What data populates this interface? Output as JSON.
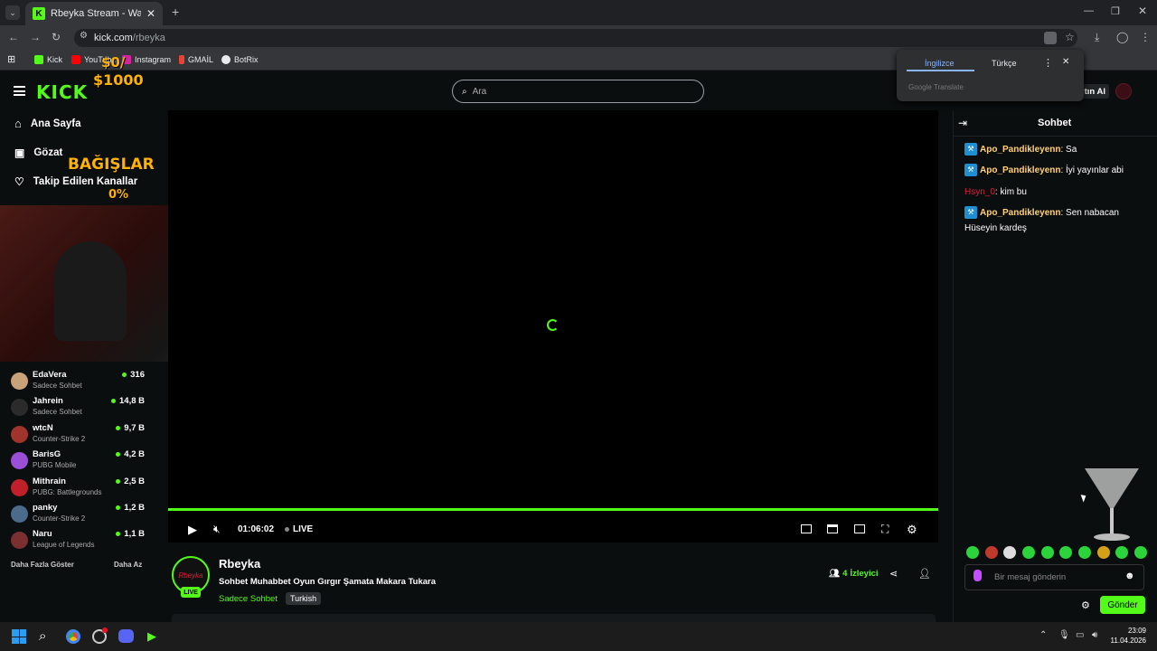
{
  "browser": {
    "tab_title": "Rbeyka Stream - Watch Live on",
    "url_host": "kick.com",
    "url_path": "/rbeyka",
    "bookmarks": [
      "Kick",
      "YouTube",
      "Instagram",
      "GMAİL",
      "BotRix"
    ]
  },
  "translate": {
    "lang_from": "İngilizce",
    "lang_to": "Türkçe",
    "brand": "Google Translate"
  },
  "site": {
    "logo": "KICK",
    "search_placeholder": "Ara",
    "login_label": "tın Al",
    "nav": [
      "Ana Sayfa",
      "Gözat",
      "Takip Edilen Kanallar"
    ]
  },
  "overlay": {
    "goal_top": "$0/",
    "goal_amount": "$1000",
    "donations": "BAĞIŞLAR",
    "percent": "0%"
  },
  "channels": [
    {
      "name": "EdaVera",
      "game": "Sadece Sohbet",
      "viewers": "316",
      "color": "#c9a27a"
    },
    {
      "name": "Jahrein",
      "game": "Sadece Sohbet",
      "viewers": "14,8 B",
      "color": "#2b2b2b"
    },
    {
      "name": "wtcN",
      "game": "Counter-Strike 2",
      "viewers": "9,7 B",
      "color": "#a0332b"
    },
    {
      "name": "BarisG",
      "game": "PUBG Mobile",
      "viewers": "4,2 B",
      "color": "#9b4fd6"
    },
    {
      "name": "Mithrain",
      "game": "PUBG: Battlegrounds",
      "viewers": "2,5 B",
      "color": "#c0202a"
    },
    {
      "name": "panky",
      "game": "Counter-Strike 2",
      "viewers": "1,2 B",
      "color": "#4a6b8a"
    },
    {
      "name": "Naru",
      "game": "League of Legends",
      "viewers": "1,1 B",
      "color": "#7a3030"
    }
  ],
  "sidebar_footer": {
    "more": "Daha Fazla Göster",
    "less": "Daha Az"
  },
  "player": {
    "time": "01:06:02",
    "live_label": "LIVE"
  },
  "stream": {
    "streamer": "Rbeyka",
    "title": "Sohbet Muhabbet Oyun Gırgır Şamata Makara Tukara",
    "category": "Sadece Sohbet",
    "tag": "Turkish",
    "viewers_count": "4",
    "viewers_label": "İzleyici",
    "live_badge": "LIVE",
    "avatar_text": "Rbeyka"
  },
  "chat": {
    "title": "Sohbet",
    "messages": [
      {
        "user": "Apo_Pandikleyenn",
        "text": "Sa"
      },
      {
        "user": "Apo_Pandikleyenn",
        "text": "İyi yayınlar abi"
      },
      {
        "user": "Hsyn_0",
        "text": "kim bu"
      },
      {
        "user": "Apo_Pandikleyenn",
        "text": "Sen nabacan Hüseyin kardeş"
      }
    ],
    "input_placeholder": "Bir mesaj gönderin",
    "send_label": "Gönder"
  },
  "taskbar": {
    "time": "23:09",
    "date": "11.04.2026"
  }
}
